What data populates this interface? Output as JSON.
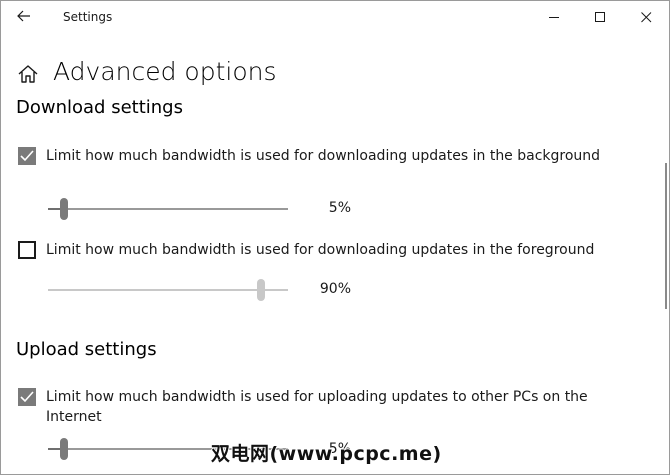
{
  "window": {
    "title": "Settings"
  },
  "header": {
    "title": "Advanced options"
  },
  "download": {
    "title": "Download settings",
    "background": {
      "label": "Limit how much bandwidth is used for downloading updates in the background",
      "checked": true,
      "value_label": "5%",
      "value": 5
    },
    "foreground": {
      "label": "Limit how much bandwidth is used for downloading updates in the foreground",
      "checked": false,
      "value_label": "90%",
      "value": 90
    }
  },
  "upload": {
    "title": "Upload settings",
    "internet": {
      "label": "Limit how much bandwidth is used for uploading updates to other PCs on the Internet",
      "checked": true,
      "value_label": "5%",
      "value": 5
    }
  },
  "watermark": "双电网(www.pcpc.me)",
  "icons": {
    "back": "back-arrow-icon",
    "home": "home-icon",
    "minimize": "minimize-icon",
    "maximize": "maximize-icon",
    "close": "close-icon",
    "check": "check-icon"
  },
  "colors": {
    "checkbox_checked": "#7a7a7a",
    "slider_active": "#7a7a7a",
    "slider_disabled": "#c8c8c8"
  }
}
